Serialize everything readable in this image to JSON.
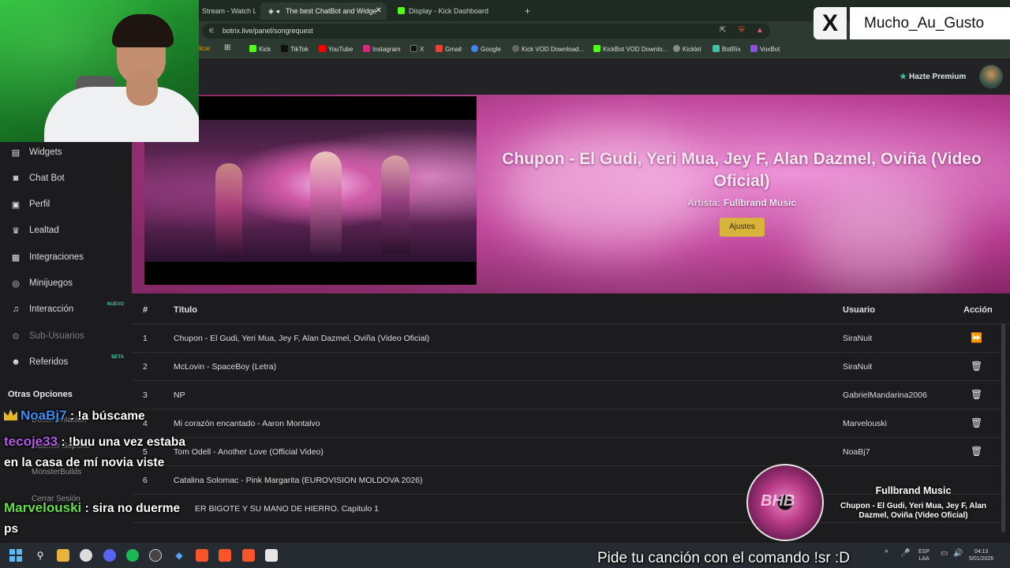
{
  "browser": {
    "tabs": [
      {
        "label": "Stream - Watch Li",
        "active": false
      },
      {
        "label": "The best ChatBot and Widge",
        "active": true
      },
      {
        "label": "Display - Kick Dashboard",
        "active": false
      }
    ],
    "new_tab": "+",
    "url": "botrix.live/panel/songrequest",
    "bookmarks": [
      {
        "label": "licar",
        "color": "#d6a11c"
      },
      {
        "label": "Kick",
        "color": "#53fc18"
      },
      {
        "label": "TikTok",
        "color": "#111111"
      },
      {
        "label": "YouTube",
        "color": "#ff0000"
      },
      {
        "label": "Instagram",
        "color": "#d6287b"
      },
      {
        "label": "X",
        "color": "#111111"
      },
      {
        "label": "Gmail",
        "color": "#ea4335"
      },
      {
        "label": "Google",
        "color": "#4285f4"
      },
      {
        "label": "Kick VOD Download...",
        "color": "#666666"
      },
      {
        "label": "KickBot VOD Downlo...",
        "color": "#53fc18"
      },
      {
        "label": "Kicklet",
        "color": "#888888"
      },
      {
        "label": "BotRix",
        "color": "#3fc4a1"
      },
      {
        "label": "VoxBot",
        "color": "#8a4fe0"
      }
    ]
  },
  "header": {
    "premium_label": "Hazte Premium"
  },
  "sidebar": {
    "items": [
      {
        "label": "Widgets",
        "icon": "widgets-icon",
        "glyph": "▤"
      },
      {
        "label": "Chat Bot",
        "icon": "robot-icon",
        "glyph": "◙"
      },
      {
        "label": "Perfil",
        "icon": "profile-card-icon",
        "glyph": "▣"
      },
      {
        "label": "Lealtad",
        "icon": "trophy-icon",
        "glyph": "♛"
      },
      {
        "label": "Integraciones",
        "icon": "integrations-icon",
        "glyph": "▦"
      },
      {
        "label": "Minijuegos",
        "icon": "gamepad-icon",
        "glyph": "◎"
      },
      {
        "label": "Interacción",
        "icon": "music-icon",
        "glyph": "♫",
        "badge": "NUEVO"
      },
      {
        "label": "Sub-Usuarios",
        "icon": "sub-users-icon",
        "glyph": "⚙",
        "disabled": true
      },
      {
        "label": "Referidos",
        "icon": "users-icon",
        "glyph": "☻",
        "badge": "BETA"
      }
    ],
    "section_title": "Otras Opciones",
    "other_items": [
      "Documentación",
      "Obtener Soporte",
      "MonsterBuilds",
      "Cerrar Sesión"
    ]
  },
  "now_playing": {
    "title": "Chupon - El Gudi, Yeri Mua, Jey F, Alan Dazmel, Oviña (Video Oficial)",
    "artist_label": "Artista:",
    "artist": "Fullbrand Music",
    "settings_label": "Ajustes"
  },
  "queue": {
    "headers": {
      "num": "#",
      "title": "Título",
      "user": "Usuario",
      "action": "Acción"
    },
    "rows": [
      {
        "num": "1",
        "title": "Chupon - El Gudi, Yeri Mua, Jey F, Alan Dazmel, Oviña (Video Oficial)",
        "user": "SiraNuit",
        "action": "skip-icon",
        "glyph": "⏩"
      },
      {
        "num": "2",
        "title": "McLovin - SpaceBoy (Letra)",
        "user": "SiraNuit",
        "action": "trash-icon",
        "glyph": "🗑"
      },
      {
        "num": "3",
        "title": "NP",
        "user": "GabrielMandarina2006",
        "action": "trash-icon",
        "glyph": "🗑"
      },
      {
        "num": "4",
        "title": "Mi corazón encantado - Aaron Montalvo",
        "user": "Marvelouski",
        "action": "trash-icon",
        "glyph": "🗑"
      },
      {
        "num": "5",
        "title": "Tom Odell - Another Love (Official Video)",
        "user": "NoaBj7",
        "action": "trash-icon",
        "glyph": "🗑"
      },
      {
        "num": "6",
        "title": "Catalina Solomac - Pink Margarita (EUROVISION MOLDOVA 2026)",
        "user": "",
        "action": "",
        "glyph": ""
      },
      {
        "num": "",
        "title": "ER BIGOTE Y SU MANO DE HIERRO. Capitulo 1",
        "user": "",
        "action": "",
        "glyph": ""
      }
    ]
  },
  "overlay": {
    "x_username": "Mucho_Au_Gusto",
    "x_logo": "X",
    "chat": [
      {
        "user": "NoaBj7",
        "color": "#3b8cf5",
        "message": " : !a búscame",
        "crown": true
      },
      {
        "user": "tecoje33",
        "color": "#b25be8",
        "message": " : !buu una vez estaba en la casa de mí novia viste",
        "crown": false
      },
      {
        "user": "Marvelouski",
        "color": "#64e04a",
        "message": " : sira no duerme ps",
        "crown": false
      }
    ],
    "widget_artist": "Fullbrand Music",
    "widget_song": "Chupon - El Gudi, Yeri Mua, Jey F, Alan Dazmel, Oviña (Video Oficial)",
    "disc_text": "BHB",
    "marquee": "Pide tu canción con el comando !sr :D"
  },
  "taskbar": {
    "lang_top": "ESP",
    "lang_bottom": "LAA",
    "time": "04:13",
    "date": "5/01/2026"
  }
}
